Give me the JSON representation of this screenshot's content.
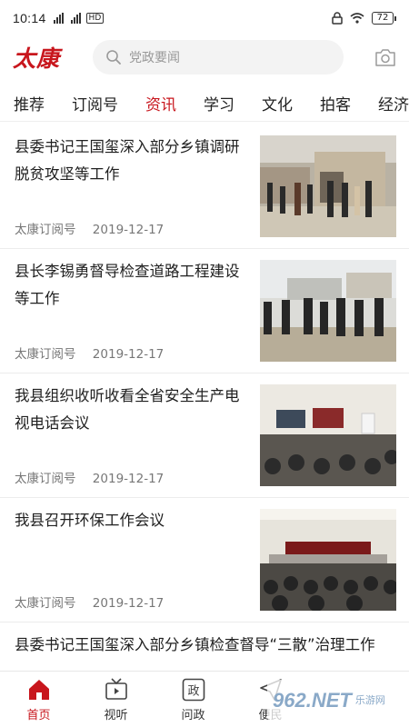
{
  "status_bar": {
    "time": "10:14",
    "network_badge": "HD",
    "battery": "72"
  },
  "header": {
    "logo_text": "太康",
    "search_placeholder": "党政要闻",
    "camera_icon": "camera-icon"
  },
  "tabs": [
    {
      "label": "推荐",
      "active": false
    },
    {
      "label": "订阅号",
      "active": false
    },
    {
      "label": "资讯",
      "active": true
    },
    {
      "label": "学习",
      "active": false
    },
    {
      "label": "文化",
      "active": false
    },
    {
      "label": "拍客",
      "active": false
    },
    {
      "label": "经济",
      "active": false
    }
  ],
  "news": [
    {
      "title": "县委书记王国玺深入部分乡镇调研脱贫攻坚等工作",
      "source": "太康订阅号",
      "date": "2019-12-17"
    },
    {
      "title": "县长李锡勇督导检查道路工程建设等工作",
      "source": "太康订阅号",
      "date": "2019-12-17"
    },
    {
      "title": "我县组织收听收看全省安全生产电视电话会议",
      "source": "太康订阅号",
      "date": "2019-12-17"
    },
    {
      "title": "我县召开环保工作会议",
      "source": "太康订阅号",
      "date": "2019-12-17"
    },
    {
      "title": "县委书记王国玺深入部分乡镇检查督导“三散”治理工作"
    }
  ],
  "bottom_nav": [
    {
      "label": "首页",
      "icon": "home-icon",
      "active": true
    },
    {
      "label": "视听",
      "icon": "tv-icon",
      "active": false
    },
    {
      "label": "问政",
      "icon": "politics-icon",
      "active": false
    },
    {
      "label": "便民",
      "icon": "send-icon",
      "active": false
    }
  ],
  "watermark": {
    "mark": "962.NET",
    "sub": "乐游网"
  },
  "colors": {
    "brand_red": "#c8161d",
    "search_bg": "#f3f3f3",
    "meta_gray": "#777777"
  }
}
